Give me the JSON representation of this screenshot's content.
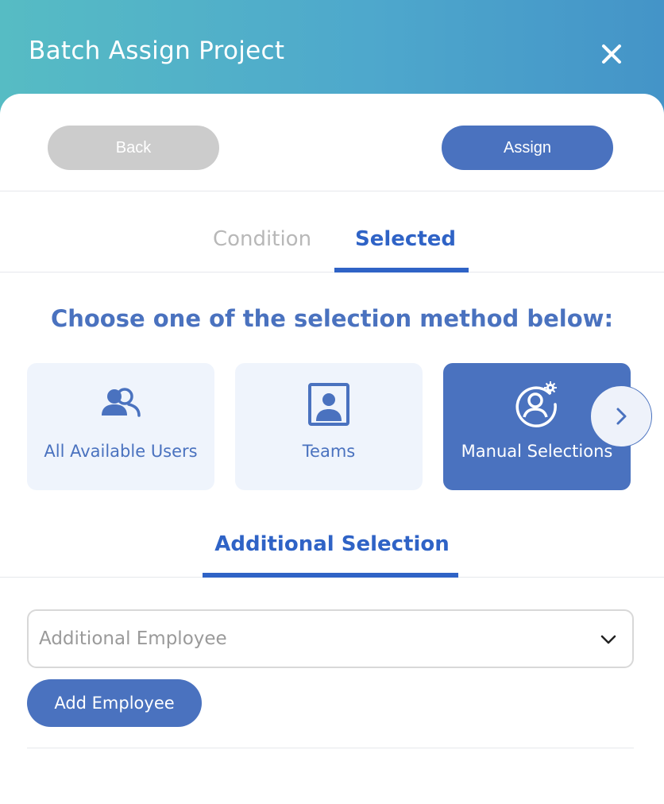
{
  "header": {
    "title": "Batch Assign Project",
    "close_icon": "close-icon"
  },
  "actions": {
    "back_label": "Back",
    "assign_label": "Assign"
  },
  "tabs": [
    {
      "label": "Condition",
      "active": false
    },
    {
      "label": "Selected",
      "active": true
    }
  ],
  "prompt": "Choose one of the selection method below:",
  "methods": [
    {
      "label": "All Available Users",
      "icon": "users-icon",
      "selected": false
    },
    {
      "label": "Teams",
      "icon": "team-portrait-icon",
      "selected": false
    },
    {
      "label": "Manual Selections",
      "icon": "user-settings-icon",
      "selected": true
    }
  ],
  "carousel": {
    "next_icon": "chevron-right-icon"
  },
  "additional": {
    "title": "Additional Selection",
    "select_placeholder": "Additional Employee",
    "add_button_label": "Add Employee"
  },
  "colors": {
    "accent": "#4a72bf",
    "tab_active": "#2f63c6",
    "header_gradient_start": "#56bcc4",
    "header_gradient_end": "#4494c8"
  }
}
